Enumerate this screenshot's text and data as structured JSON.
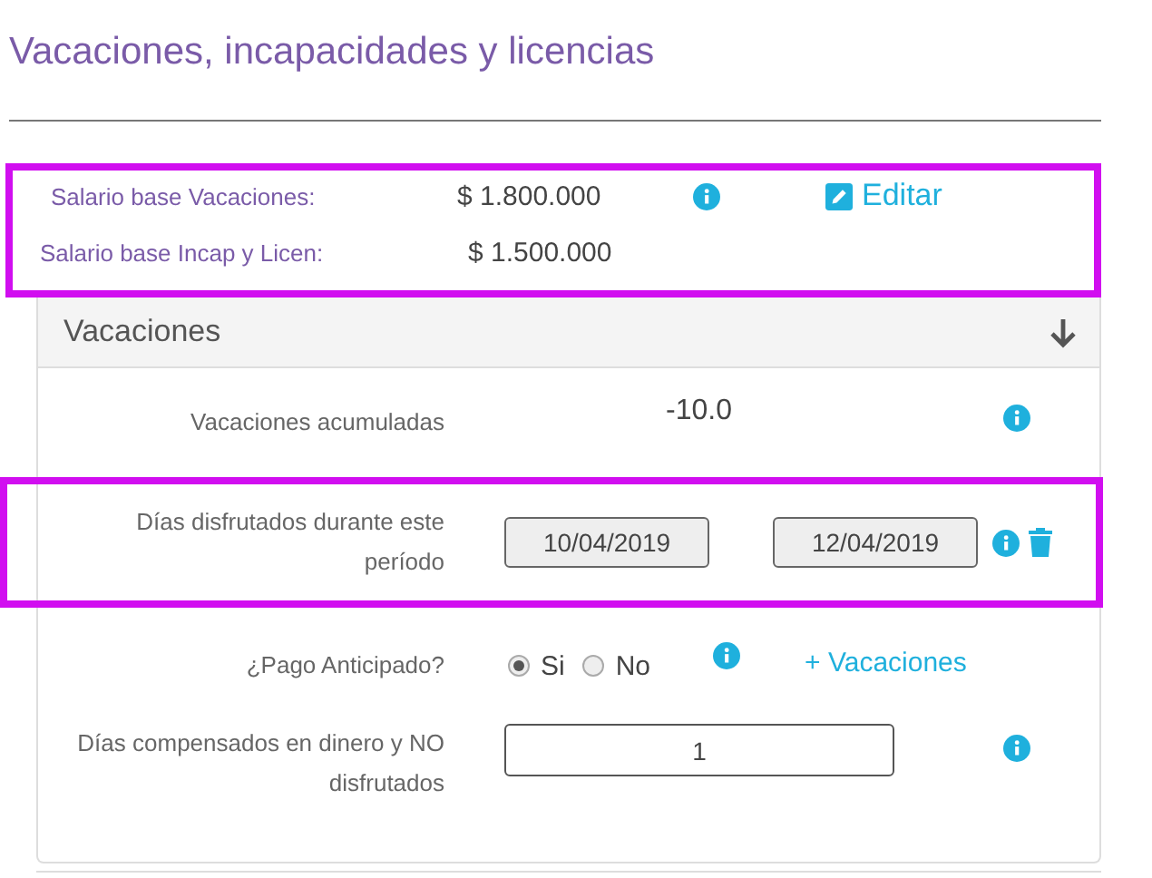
{
  "title": "Vacaciones, incapacidades y licencias",
  "salary_block": {
    "highlighted": true,
    "edit_link": "Editar",
    "salaries": [
      {
        "label": "Salario base Vacaciones:",
        "value": "$ 1.800.000",
        "info": true
      },
      {
        "label": "Salario base Incap y Licen:",
        "value": "$ 1.500.000",
        "info": false
      }
    ]
  },
  "section": {
    "title": "Vacaciones",
    "rows": [
      {
        "kind": "value",
        "label": "Vacaciones acumuladas",
        "value": "-10.0",
        "highlighted": false
      },
      {
        "kind": "date_range",
        "label": "Días disfrutados durante este período",
        "start": "10/04/2019",
        "end": "12/04/2019",
        "highlighted": true
      },
      {
        "kind": "radio",
        "label": "¿Pago Anticipado?",
        "options": [
          {
            "label": "Si",
            "selected": true
          },
          {
            "label": "No",
            "selected": false
          }
        ],
        "link": "+ Vacaciones",
        "highlighted": false
      },
      {
        "kind": "input",
        "label": "Días compensados en dinero y NO disfrutados",
        "value": "1",
        "highlighted": false
      }
    ]
  }
}
